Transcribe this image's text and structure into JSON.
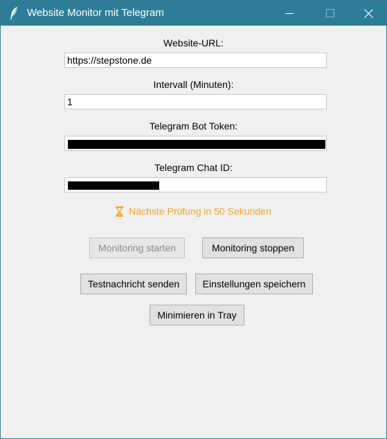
{
  "window": {
    "title": "Website Monitor mit Telegram",
    "controls": {
      "minimize_icon": "minimize-icon",
      "maximize_icon": "maximize-icon",
      "close_icon": "close-icon"
    },
    "titlebar_color": "#2e7d98"
  },
  "form": {
    "url": {
      "label": "Website-URL:",
      "value": "https://stepstone.de"
    },
    "interval": {
      "label": "Intervall (Minuten):",
      "value": "1"
    },
    "bot_token": {
      "label": "Telegram Bot Token:",
      "value": "",
      "redacted": true
    },
    "chat_id": {
      "label": "Telegram Chat ID:",
      "value": "",
      "redacted": true
    }
  },
  "status": {
    "icon": "hourglass-icon",
    "text": "Nächste Prüfung in 50 Sekunden",
    "color": "#f5a623"
  },
  "buttons": {
    "start": {
      "label": "Monitoring starten",
      "disabled": true
    },
    "stop": {
      "label": "Monitoring stoppen"
    },
    "test": {
      "label": "Testnachricht senden"
    },
    "save": {
      "label": "Einstellungen speichern"
    },
    "tray": {
      "label": "Minimieren in Tray"
    }
  }
}
